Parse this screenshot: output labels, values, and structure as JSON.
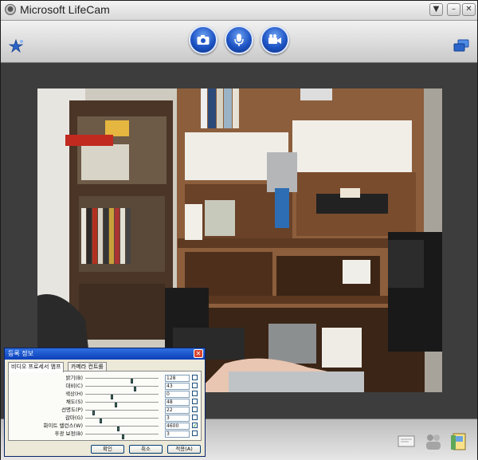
{
  "window": {
    "title": "Microsoft LifeCam",
    "controls": [
      "▼",
      "–",
      "✕"
    ]
  },
  "toolbar": {
    "buttons": [
      "camera-photo",
      "microphone",
      "video-camera"
    ]
  },
  "dialog": {
    "title": "등록 정보",
    "tabs": [
      "비디오 프로세서 앰프",
      "카메라 컨트롤"
    ],
    "rows": [
      {
        "label": "밝기(B)",
        "value": "128",
        "thumb": 0.62,
        "checked": false
      },
      {
        "label": "대비(C)",
        "value": "43",
        "thumb": 0.66,
        "checked": false
      },
      {
        "label": "색상(H)",
        "value": "0",
        "thumb": 0.35,
        "checked": false
      },
      {
        "label": "채도(S)",
        "value": "48",
        "thumb": 0.4,
        "checked": false
      },
      {
        "label": "선명도(P)",
        "value": "22",
        "thumb": 0.1,
        "checked": false
      },
      {
        "label": "감마(G)",
        "value": "3",
        "thumb": 0.2,
        "checked": false
      },
      {
        "label": "화이트 밸런스(W)",
        "value": "4600",
        "thumb": 0.44,
        "checked": true
      },
      {
        "label": "후광 보정(B)",
        "value": "3",
        "thumb": 0.5,
        "checked": false
      }
    ],
    "buttons": {
      "ok": "확인",
      "cancel": "취소",
      "apply": "적용(A)"
    }
  }
}
